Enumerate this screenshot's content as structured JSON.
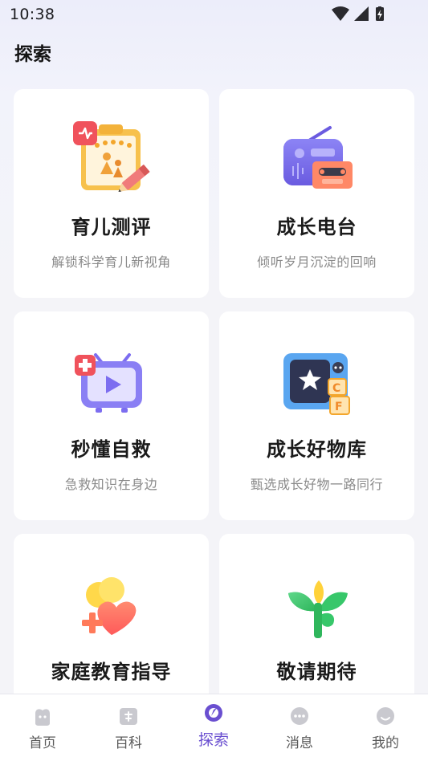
{
  "status_bar": {
    "time": "10:38",
    "icons": [
      "wifi-icon",
      "signal-icon",
      "battery-icon"
    ]
  },
  "page": {
    "title": "探索"
  },
  "cards": [
    {
      "title": "育儿测评",
      "subtitle": "解锁科学育儿新视角",
      "icon": "parenting-assessment-icon"
    },
    {
      "title": "成长电台",
      "subtitle": "倾听岁月沉淀的回响",
      "icon": "radio-icon"
    },
    {
      "title": "秒懂自救",
      "subtitle": "急救知识在身边",
      "icon": "first-aid-video-icon"
    },
    {
      "title": "成长好物库",
      "subtitle": "甄选成长好物一路同行",
      "icon": "goods-library-icon"
    },
    {
      "title": "家庭教育指导",
      "subtitle": "",
      "icon": "family-education-icon"
    },
    {
      "title": "敬请期待",
      "subtitle": "",
      "icon": "sprout-icon"
    }
  ],
  "bottom_nav": {
    "items": [
      {
        "label": "首页",
        "icon": "home-icon"
      },
      {
        "label": "百科",
        "icon": "encyclopedia-icon"
      },
      {
        "label": "探索",
        "icon": "explore-icon",
        "active": true
      },
      {
        "label": "消息",
        "icon": "message-icon"
      },
      {
        "label": "我的",
        "icon": "profile-icon"
      }
    ]
  },
  "colors": {
    "accent": "#6a4fd0",
    "card_bg": "#ffffff",
    "page_bg": "#f2f3fb"
  }
}
